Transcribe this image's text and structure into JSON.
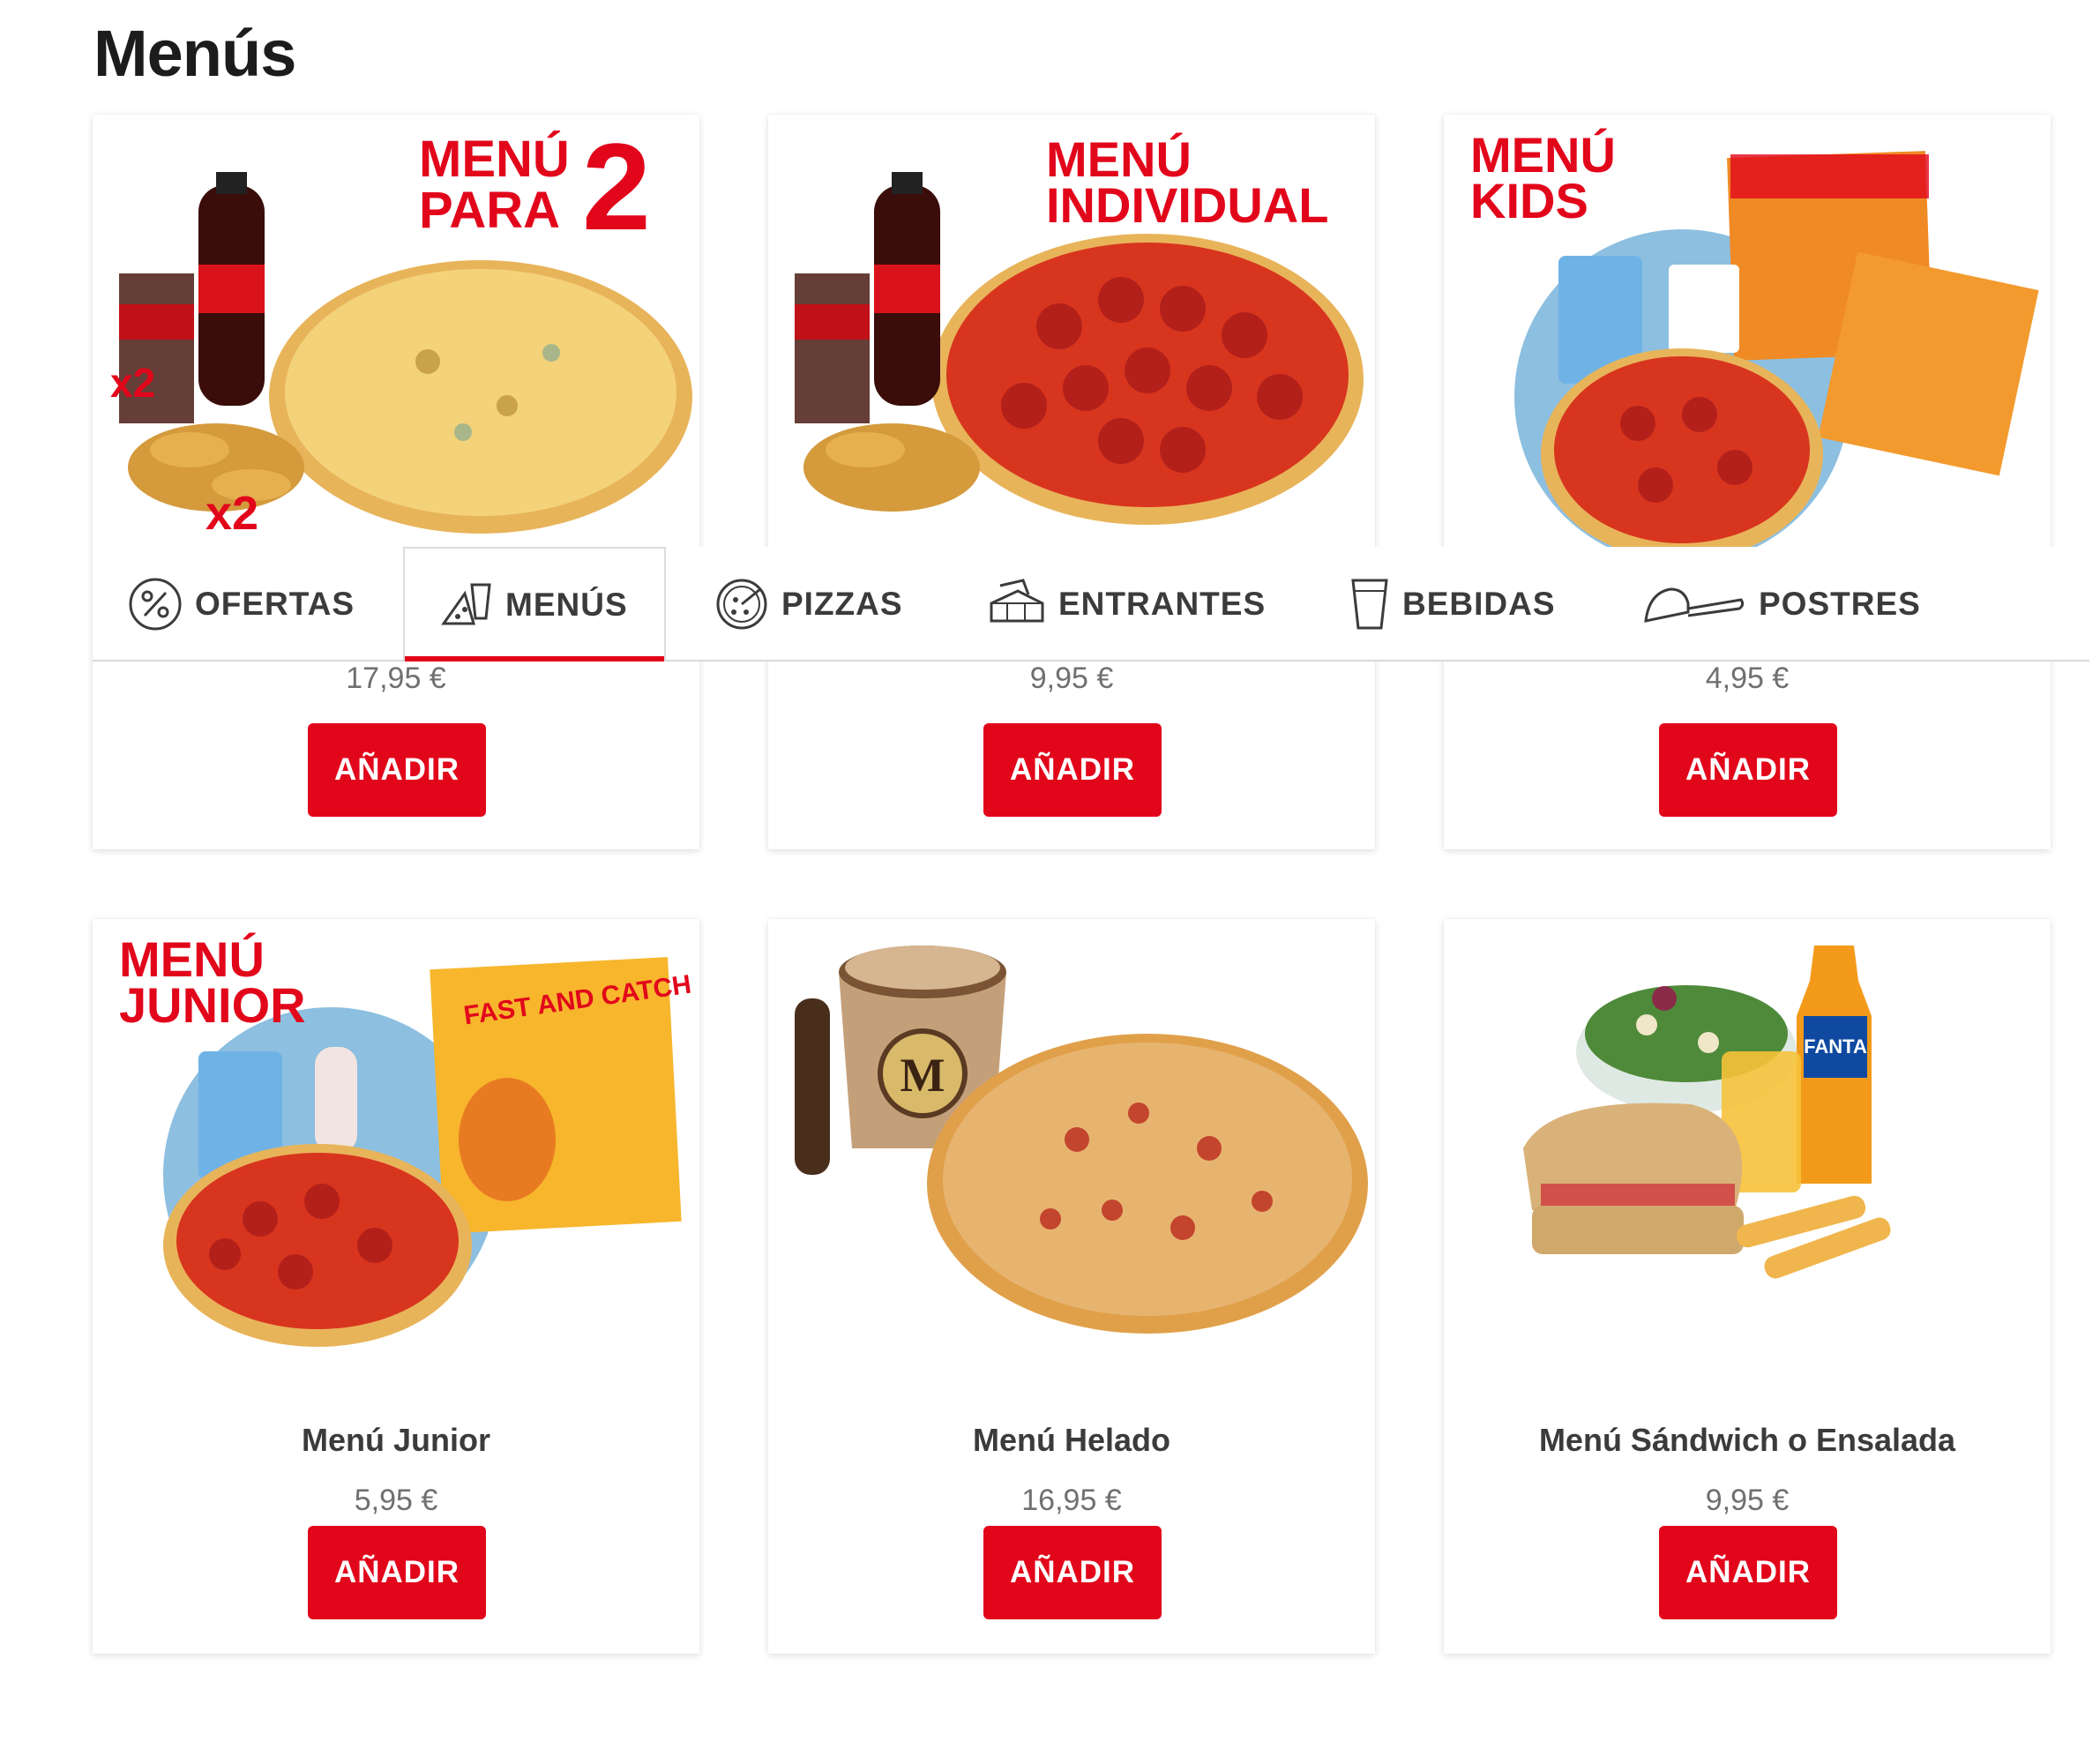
{
  "page": {
    "title": "Menús"
  },
  "nav": {
    "tabs": [
      {
        "label": "OFERTAS",
        "icon": "percent-icon"
      },
      {
        "label": "MENÚS",
        "icon": "pizza-drink-icon",
        "active": true
      },
      {
        "label": "PIZZAS",
        "icon": "pizza-icon"
      },
      {
        "label": "ENTRANTES",
        "icon": "starter-box-icon"
      },
      {
        "label": "BEBIDAS",
        "icon": "cup-icon"
      },
      {
        "label": "POSTRES",
        "icon": "dessert-icon"
      }
    ]
  },
  "menus": [
    {
      "banner": [
        "MENÚ",
        "PARA"
      ],
      "banner_big": "2",
      "price": "17,95 €",
      "button": "AÑADIR",
      "badges": [
        "x2",
        "x2"
      ]
    },
    {
      "banner": [
        "MENÚ",
        "INDIVIDUAL"
      ],
      "price": "9,95 €",
      "button": "AÑADIR"
    },
    {
      "banner": [
        "MENÚ",
        "KIDS"
      ],
      "price": "4,95 €",
      "button": "AÑADIR"
    },
    {
      "banner": [
        "MENÚ",
        "JUNIOR"
      ],
      "name": "Menú Junior",
      "price": "5,95 €",
      "button": "AÑADIR",
      "book_title": "FAST AND CATCH"
    },
    {
      "name": "Menú Helado",
      "price": "16,95 €",
      "button": "AÑADIR",
      "tub_letter": "M"
    },
    {
      "name": "Menú Sándwich o Ensalada",
      "price": "9,95 €",
      "button": "AÑADIR",
      "bottle_label": "FANTA"
    }
  ],
  "colors": {
    "brand_red": "#e2061b",
    "text_dark": "#3b3b3b",
    "price_gray": "#707070"
  }
}
